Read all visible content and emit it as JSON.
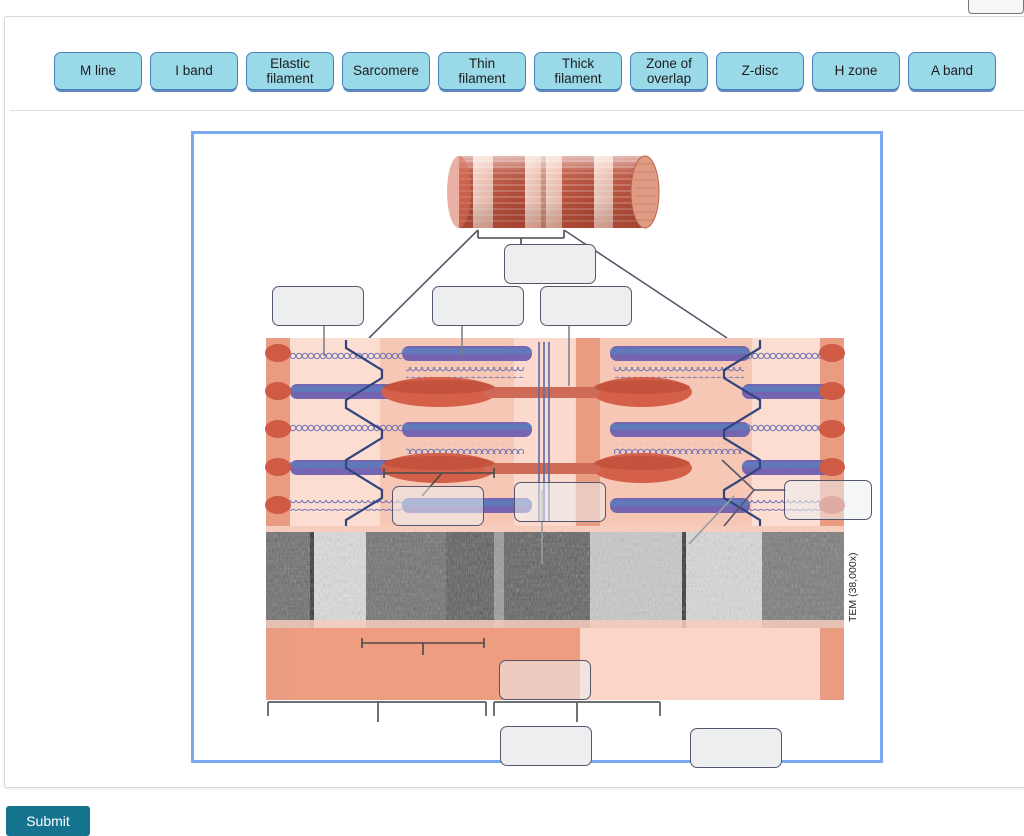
{
  "window": {
    "top_button_label": "",
    "submit_label": "Submit"
  },
  "word_bank": {
    "name": "word-bank",
    "chip_fill": "#9ad9e8",
    "chip_border": "#4a7fbf",
    "items": [
      {
        "label": "M line"
      },
      {
        "label": "I band"
      },
      {
        "label": "Elastic\nfilament"
      },
      {
        "label": "Sarcomere"
      },
      {
        "label": "Thin\nfilament"
      },
      {
        "label": "Thick\nfilament"
      },
      {
        "label": "Zone of\noverlap"
      },
      {
        "label": "Z-disc"
      },
      {
        "label": "H zone"
      },
      {
        "label": "A band"
      }
    ]
  },
  "diagram": {
    "title": "",
    "frame_color": "#7aa9f2",
    "micrograph_caption": "TEM (38,000x)",
    "answer_slots": [
      {
        "id": "slot-myofibril-top",
        "value": ""
      },
      {
        "id": "slot-upper-left",
        "value": ""
      },
      {
        "id": "slot-upper-mid",
        "value": ""
      },
      {
        "id": "slot-upper-right",
        "value": ""
      },
      {
        "id": "slot-mid-left",
        "value": ""
      },
      {
        "id": "slot-mid-center",
        "value": ""
      },
      {
        "id": "slot-mid-right",
        "value": ""
      },
      {
        "id": "slot-lower-center",
        "value": ""
      },
      {
        "id": "slot-bottom-left",
        "value": ""
      },
      {
        "id": "slot-bottom-right",
        "value": ""
      }
    ]
  }
}
